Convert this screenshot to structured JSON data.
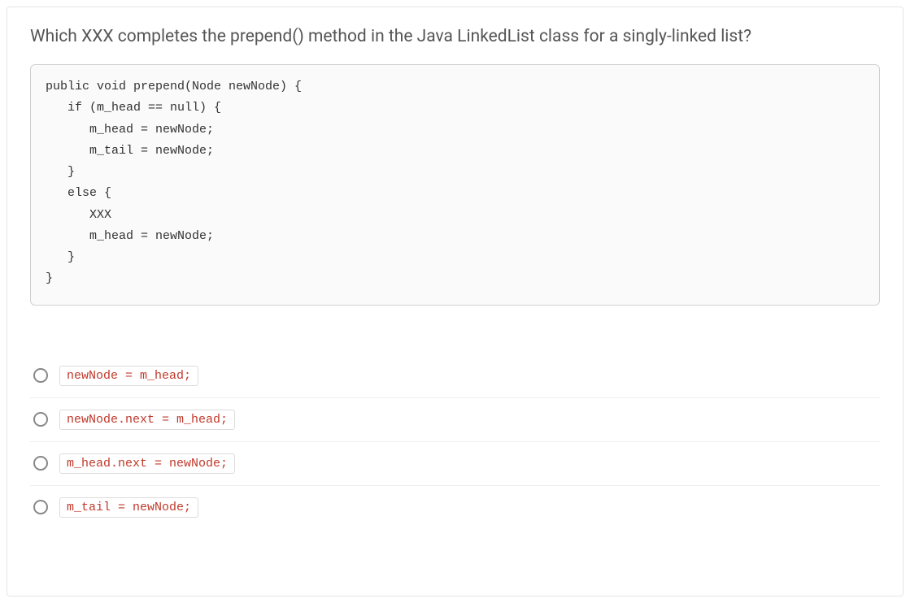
{
  "question": "Which XXX completes the prepend() method in the Java LinkedList class for a singly-linked list?",
  "code": "public void prepend(Node newNode) {\n   if (m_head == null) {\n      m_head = newNode;\n      m_tail = newNode;\n   }\n   else {\n      XXX\n      m_head = newNode;\n   }\n}",
  "options": [
    {
      "label": "newNode = m_head;"
    },
    {
      "label": "newNode.next = m_head;"
    },
    {
      "label": "m_head.next = newNode;"
    },
    {
      "label": "m_tail = newNode;"
    }
  ]
}
